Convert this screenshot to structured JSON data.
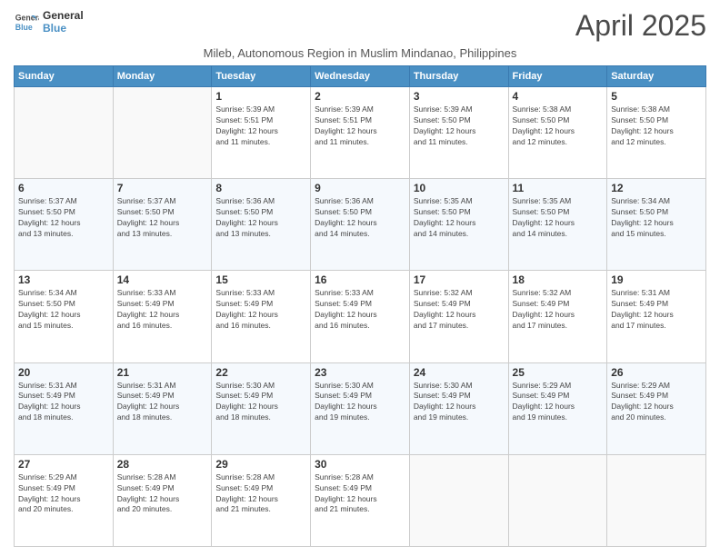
{
  "logo": {
    "line1": "General",
    "line2": "Blue"
  },
  "title": "April 2025",
  "subtitle": "Mileb, Autonomous Region in Muslim Mindanao, Philippines",
  "days_header": [
    "Sunday",
    "Monday",
    "Tuesday",
    "Wednesday",
    "Thursday",
    "Friday",
    "Saturday"
  ],
  "weeks": [
    [
      {
        "day": "",
        "info": ""
      },
      {
        "day": "",
        "info": ""
      },
      {
        "day": "1",
        "info": "Sunrise: 5:39 AM\nSunset: 5:51 PM\nDaylight: 12 hours\nand 11 minutes."
      },
      {
        "day": "2",
        "info": "Sunrise: 5:39 AM\nSunset: 5:51 PM\nDaylight: 12 hours\nand 11 minutes."
      },
      {
        "day": "3",
        "info": "Sunrise: 5:39 AM\nSunset: 5:50 PM\nDaylight: 12 hours\nand 11 minutes."
      },
      {
        "day": "4",
        "info": "Sunrise: 5:38 AM\nSunset: 5:50 PM\nDaylight: 12 hours\nand 12 minutes."
      },
      {
        "day": "5",
        "info": "Sunrise: 5:38 AM\nSunset: 5:50 PM\nDaylight: 12 hours\nand 12 minutes."
      }
    ],
    [
      {
        "day": "6",
        "info": "Sunrise: 5:37 AM\nSunset: 5:50 PM\nDaylight: 12 hours\nand 13 minutes."
      },
      {
        "day": "7",
        "info": "Sunrise: 5:37 AM\nSunset: 5:50 PM\nDaylight: 12 hours\nand 13 minutes."
      },
      {
        "day": "8",
        "info": "Sunrise: 5:36 AM\nSunset: 5:50 PM\nDaylight: 12 hours\nand 13 minutes."
      },
      {
        "day": "9",
        "info": "Sunrise: 5:36 AM\nSunset: 5:50 PM\nDaylight: 12 hours\nand 14 minutes."
      },
      {
        "day": "10",
        "info": "Sunrise: 5:35 AM\nSunset: 5:50 PM\nDaylight: 12 hours\nand 14 minutes."
      },
      {
        "day": "11",
        "info": "Sunrise: 5:35 AM\nSunset: 5:50 PM\nDaylight: 12 hours\nand 14 minutes."
      },
      {
        "day": "12",
        "info": "Sunrise: 5:34 AM\nSunset: 5:50 PM\nDaylight: 12 hours\nand 15 minutes."
      }
    ],
    [
      {
        "day": "13",
        "info": "Sunrise: 5:34 AM\nSunset: 5:50 PM\nDaylight: 12 hours\nand 15 minutes."
      },
      {
        "day": "14",
        "info": "Sunrise: 5:33 AM\nSunset: 5:49 PM\nDaylight: 12 hours\nand 16 minutes."
      },
      {
        "day": "15",
        "info": "Sunrise: 5:33 AM\nSunset: 5:49 PM\nDaylight: 12 hours\nand 16 minutes."
      },
      {
        "day": "16",
        "info": "Sunrise: 5:33 AM\nSunset: 5:49 PM\nDaylight: 12 hours\nand 16 minutes."
      },
      {
        "day": "17",
        "info": "Sunrise: 5:32 AM\nSunset: 5:49 PM\nDaylight: 12 hours\nand 17 minutes."
      },
      {
        "day": "18",
        "info": "Sunrise: 5:32 AM\nSunset: 5:49 PM\nDaylight: 12 hours\nand 17 minutes."
      },
      {
        "day": "19",
        "info": "Sunrise: 5:31 AM\nSunset: 5:49 PM\nDaylight: 12 hours\nand 17 minutes."
      }
    ],
    [
      {
        "day": "20",
        "info": "Sunrise: 5:31 AM\nSunset: 5:49 PM\nDaylight: 12 hours\nand 18 minutes."
      },
      {
        "day": "21",
        "info": "Sunrise: 5:31 AM\nSunset: 5:49 PM\nDaylight: 12 hours\nand 18 minutes."
      },
      {
        "day": "22",
        "info": "Sunrise: 5:30 AM\nSunset: 5:49 PM\nDaylight: 12 hours\nand 18 minutes."
      },
      {
        "day": "23",
        "info": "Sunrise: 5:30 AM\nSunset: 5:49 PM\nDaylight: 12 hours\nand 19 minutes."
      },
      {
        "day": "24",
        "info": "Sunrise: 5:30 AM\nSunset: 5:49 PM\nDaylight: 12 hours\nand 19 minutes."
      },
      {
        "day": "25",
        "info": "Sunrise: 5:29 AM\nSunset: 5:49 PM\nDaylight: 12 hours\nand 19 minutes."
      },
      {
        "day": "26",
        "info": "Sunrise: 5:29 AM\nSunset: 5:49 PM\nDaylight: 12 hours\nand 20 minutes."
      }
    ],
    [
      {
        "day": "27",
        "info": "Sunrise: 5:29 AM\nSunset: 5:49 PM\nDaylight: 12 hours\nand 20 minutes."
      },
      {
        "day": "28",
        "info": "Sunrise: 5:28 AM\nSunset: 5:49 PM\nDaylight: 12 hours\nand 20 minutes."
      },
      {
        "day": "29",
        "info": "Sunrise: 5:28 AM\nSunset: 5:49 PM\nDaylight: 12 hours\nand 21 minutes."
      },
      {
        "day": "30",
        "info": "Sunrise: 5:28 AM\nSunset: 5:49 PM\nDaylight: 12 hours\nand 21 minutes."
      },
      {
        "day": "",
        "info": ""
      },
      {
        "day": "",
        "info": ""
      },
      {
        "day": "",
        "info": ""
      }
    ]
  ]
}
